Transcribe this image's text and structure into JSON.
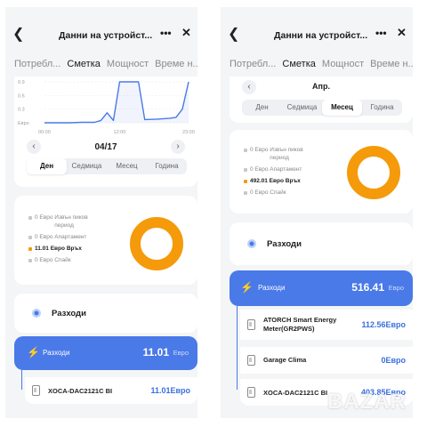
{
  "colors": {
    "accent": "#3b6fe6",
    "donut": "#f59a0a",
    "bar": "#4a79e8"
  },
  "left": {
    "title": "Данни на устройст...",
    "tabs": [
      "Потребл...",
      "Сметка",
      "Мощност",
      "Време н..."
    ],
    "chart": {
      "y_ticks": [
        "0.9",
        "0.6",
        "0.3",
        "Евро"
      ],
      "x_ticks": [
        "00:00",
        "12:00",
        "23:00"
      ]
    },
    "chart_data": {
      "type": "line",
      "x_ticks": [
        "00:00",
        "12:00",
        "23:00"
      ],
      "y_ticks": [
        "0.9",
        "0.6",
        "0.3"
      ],
      "ylim": [
        0,
        0.9
      ],
      "x": [
        0,
        2,
        4,
        6,
        8,
        9,
        10,
        11,
        12,
        13,
        14,
        15,
        16,
        18,
        20,
        21,
        22,
        23
      ],
      "values": [
        0,
        0,
        0,
        0.01,
        0.01,
        0.05,
        0.22,
        0.05,
        0.9,
        0.9,
        0.9,
        0.9,
        0.07,
        0.08,
        0.1,
        0.12,
        0.3,
        0.9
      ]
    },
    "date": "04/17",
    "periods": [
      "Ден",
      "Седмица",
      "Месец",
      "Година"
    ],
    "legend": [
      {
        "value": "0 Евро",
        "label": "Извън пиков период",
        "highlight": false
      },
      {
        "value": "0 Евро",
        "label": "Апартамент",
        "highlight": false
      },
      {
        "value": "11.01 Евро",
        "label": "Връх",
        "highlight": true
      },
      {
        "value": "0 Евро",
        "label": "Спайк",
        "highlight": false
      }
    ],
    "expenses_title": "Разходи",
    "bar": {
      "label": "Разходи",
      "amount": "11.01",
      "unit": "Евро"
    },
    "devices": [
      {
        "name": "XOCA-DAC2121C BI",
        "value": "11.01Евро"
      }
    ]
  },
  "right": {
    "title": "Данни на устройст...",
    "tabs": [
      "Потребл...",
      "Сметка",
      "Мощност",
      "Време н..."
    ],
    "month": "Апр.",
    "periods": [
      "Ден",
      "Седмица",
      "Месец",
      "Година"
    ],
    "legend": [
      {
        "value": "0 Евро",
        "label": "Извън пиков период",
        "highlight": false
      },
      {
        "value": "0 Евро",
        "label": "Апартамент",
        "highlight": false
      },
      {
        "value": "492.01 Евро",
        "label": "Връх",
        "highlight": true
      },
      {
        "value": "0 Евро",
        "label": "Спайк",
        "highlight": false
      }
    ],
    "expenses_title": "Разходи",
    "bar": {
      "label": "Разходи",
      "amount": "516.41",
      "unit": "Евро"
    },
    "devices": [
      {
        "name": "ATORCH Smart Energy Meter(GR2PWS)",
        "value": "112.56Евро"
      },
      {
        "name": "Garage Clima",
        "value": "0Евро"
      },
      {
        "name": "XOCA-DAC2121C BI",
        "value": "403.85Евро"
      }
    ]
  },
  "watermark": "BAZAR"
}
